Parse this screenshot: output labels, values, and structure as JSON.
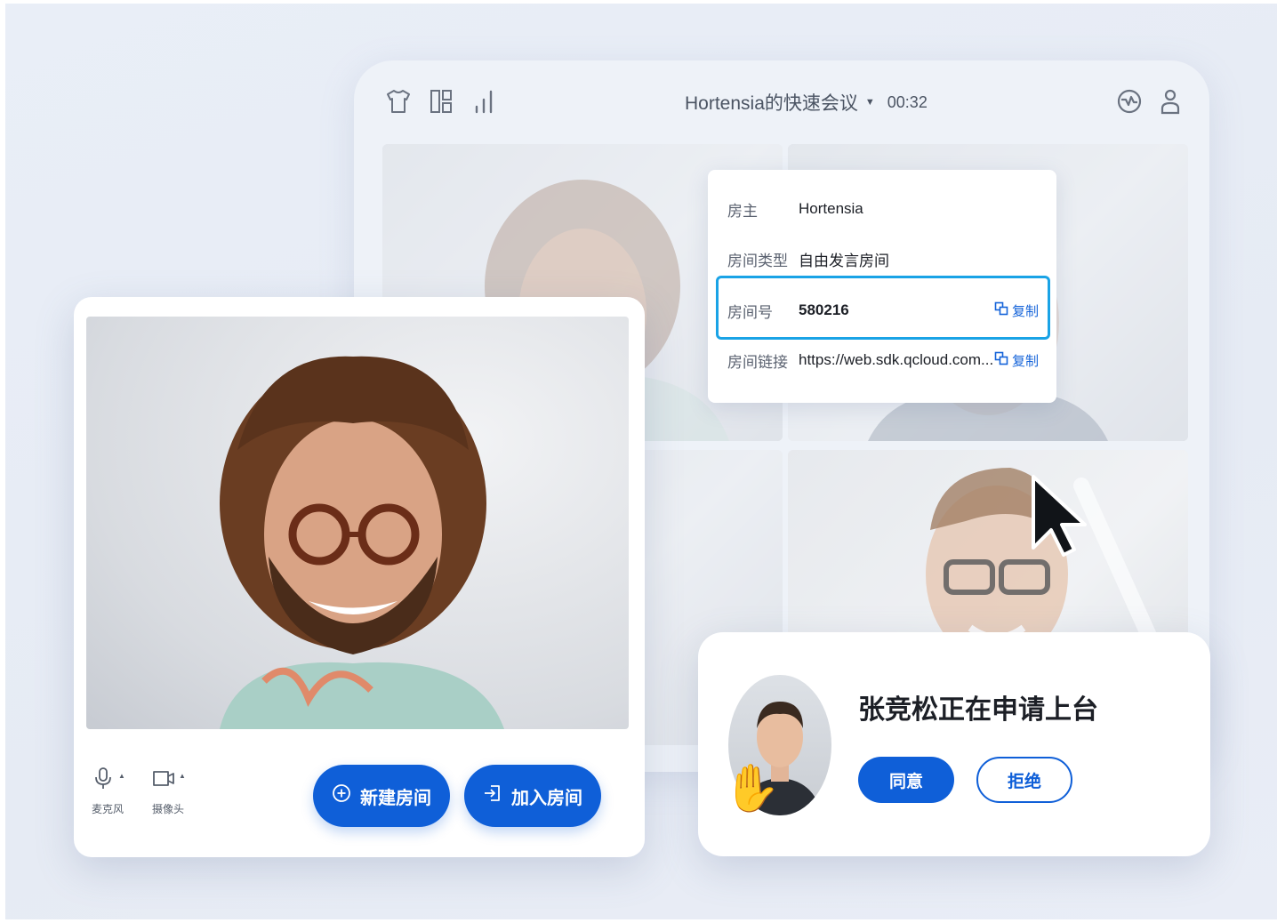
{
  "meeting": {
    "title": "Hortensia的快速会议",
    "timer": "00:32"
  },
  "room_info": {
    "owner_label": "房主",
    "owner_value": "Hortensia",
    "type_label": "房间类型",
    "type_value": "自由发言房间",
    "id_label": "房间号",
    "id_value": "580216",
    "link_label": "房间链接",
    "link_value": "https://web.sdk.qcloud.com...",
    "copy_label": "复制"
  },
  "preview": {
    "mic_label": "麦克风",
    "camera_label": "摄像头",
    "new_room_label": "新建房间",
    "join_room_label": "加入房间"
  },
  "raise_hand": {
    "message": "张竞松正在申请上台",
    "agree_label": "同意",
    "reject_label": "拒绝"
  },
  "icons": {
    "topbar_left": [
      "shirt-icon",
      "layout-icon",
      "signal-icon"
    ],
    "topbar_right": [
      "network-icon",
      "user-icon"
    ],
    "copy": "copy-icon",
    "mic": "mic-icon",
    "camera": "camera-icon",
    "plus_circle": "plus-circle-icon",
    "enter": "enter-icon",
    "raise_hand": "raise-hand-icon"
  },
  "colors": {
    "primary": "#0f5fd8",
    "highlight": "#1aa3e6",
    "background": "#e9eef7"
  }
}
